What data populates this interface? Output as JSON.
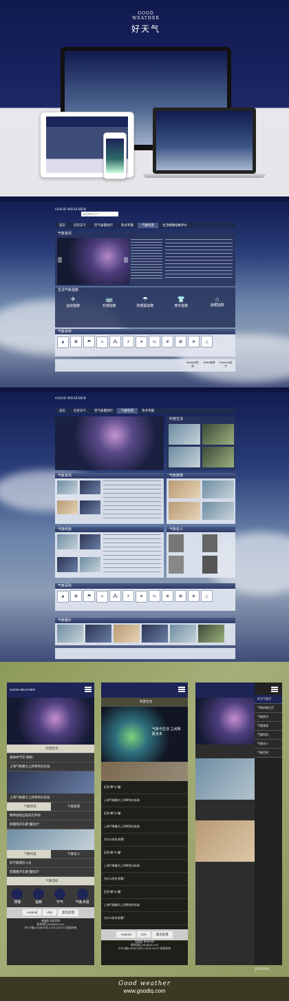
{
  "header": {
    "logo_text": "GOOD WEATHER",
    "title_cn": "好天气"
  },
  "desktop": {
    "nav": [
      "首页",
      "历史天气",
      "空气质量排行",
      "热点专题",
      "气象科普",
      "生活健康指数评价"
    ],
    "search_placeholder": "搜索城市天气",
    "section_titles": {
      "news": "气象资讯",
      "life": "生活气象指数",
      "encyclopedia": "气象百科"
    },
    "life_items": [
      "运动指数",
      "交通指数",
      "防晒黑指数",
      "穿衣指数",
      "褪晒指数"
    ],
    "encyclopedia_tabs": [
      "冷暖",
      "保暖",
      "节气",
      "天气风景"
    ],
    "weather_icon_labels": [
      "台风",
      "大雪",
      "大雨",
      "大风",
      "冰雹",
      "暴雨",
      "大雾",
      "沙尘暴",
      "寒冷",
      "霜冻",
      "干旱",
      "高温"
    ],
    "footer_buttons": [
      "Mobile手机版",
      "Weibo微博",
      "Facebook脸书"
    ]
  },
  "desktop2": {
    "nav": [
      "首页",
      "历史天气",
      "空气质量排行",
      "气象科普",
      "热点专题"
    ],
    "section_titles": {
      "life": "科普生活",
      "news": "气象资讯",
      "tourism": "气象旅游",
      "tech": "气象科技",
      "people": "气象名人",
      "encyclopedia": "气象百科",
      "pictures": "气象图片"
    }
  },
  "mobile": {
    "phone1_sections": [
      "科普生活",
      "气象资讯",
      "气象旅游",
      "气象科技",
      "气象名人",
      "气象百科"
    ],
    "phone1_links": [
      "黄梅季节在“梅雨”",
      "上海气象最大上四季划分标准",
      "精神发射出现日历开始",
      "新疆现开车暴“露指示”",
      "科学家揭开人员",
      "新疆暴开车暴“露指示”"
    ],
    "phone1_icons": [
      "预警",
      "指数",
      "节气",
      "气象术语"
    ],
    "phone2_title": "科普生活",
    "phone2_banner": "气象与生活 之间相距多多",
    "phone2_links": [
      "区别“雾”与“霾”",
      "上海气象最大上四季划分标准",
      "区别“雾”与“霾”",
      "上海气象最大上四季划分标准",
      "为什么秋冬多雾？",
      "区别“雾”与“霾”",
      "上海气象最大上四季划分标准",
      "为什么秋冬多雾？",
      "区别“雾”与“霾”",
      "上海气象最大上四季划分标准",
      "为什么秋冬多雾？",
      "区别“雾”与“霾”"
    ],
    "phone3_menu": [
      "好天气首页",
      "气象科普主页",
      "气象资讯",
      "气象旅游",
      "气象科技",
      "气象名人",
      "气象百科"
    ],
    "bottom_tabs": [
      "Android",
      "IOS",
      "意见反馈"
    ],
    "footer_text": [
      "电脑版 免责声明",
      "联系我们:info@QZ.com",
      "沪ICP备12345678号-2 2013-2017© 版权所有"
    ],
    "signature": "yvonne"
  },
  "footer": {
    "script_text": "Good weather",
    "url": "www.goodtq.com"
  }
}
